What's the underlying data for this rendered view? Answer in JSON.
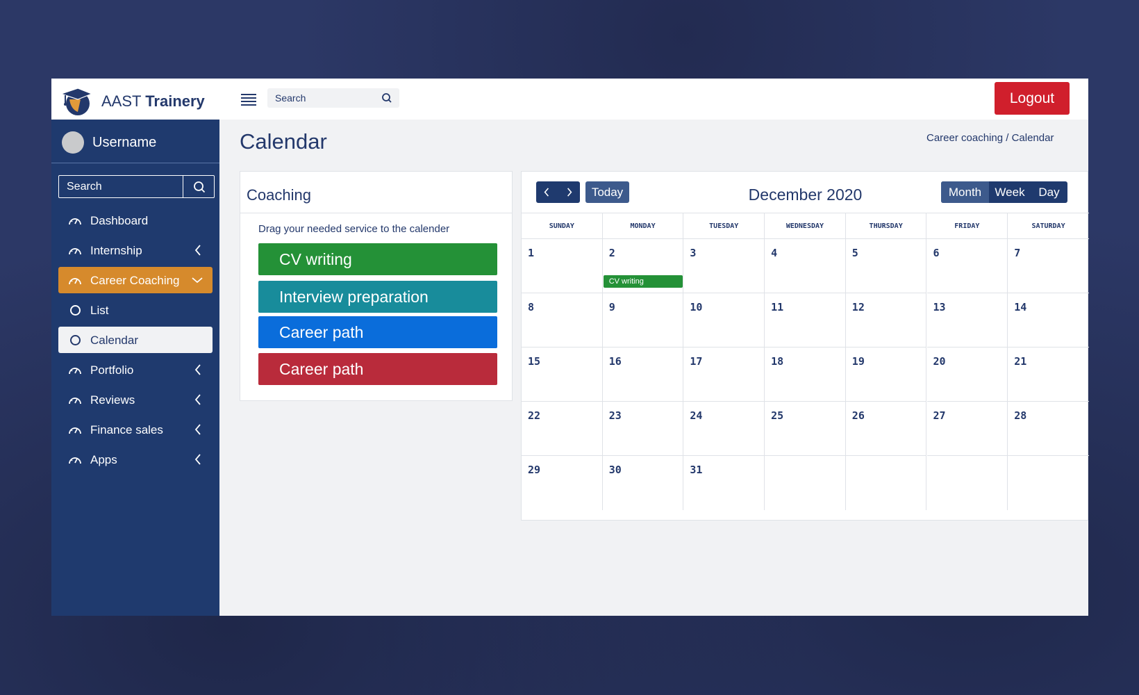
{
  "brand": {
    "prefix": "AAST",
    "name": "Trainery"
  },
  "topbar": {
    "search_placeholder": "Search",
    "logout_label": "Logout"
  },
  "sidebar": {
    "username": "Username",
    "search_placeholder": "Search",
    "items": [
      {
        "label": "Dashboard"
      },
      {
        "label": "Internship"
      },
      {
        "label": "Career Coaching"
      },
      {
        "label": "List"
      },
      {
        "label": "Calendar"
      },
      {
        "label": "Portfolio"
      },
      {
        "label": "Reviews"
      },
      {
        "label": "Finance sales"
      },
      {
        "label": "Apps"
      }
    ]
  },
  "page": {
    "title": "Calendar",
    "breadcrumb": "Career coaching / Calendar"
  },
  "coaching": {
    "title": "Coaching",
    "hint": "Drag your needed service to the calender",
    "services": [
      {
        "label": "CV writing",
        "color": "#249137"
      },
      {
        "label": "Interview preparation",
        "color": "#188c9b"
      },
      {
        "label": "Career path",
        "color": "#0a6ddb"
      },
      {
        "label": "Career path",
        "color": "#b92b3b"
      }
    ]
  },
  "calendar": {
    "month_label": "December 2020",
    "today_label": "Today",
    "views": [
      "Month",
      "Week",
      "Day"
    ],
    "active_view": "Month",
    "weekdays": [
      "SUNDAY",
      "MONDAY",
      "TUESDAY",
      "WEDNESDAY",
      "THURSDAY",
      "FRIDAY",
      "SATURDAY"
    ],
    "days": [
      [
        "1",
        "2",
        "3",
        "4",
        "5",
        "6",
        "7"
      ],
      [
        "8",
        "9",
        "10",
        "11",
        "12",
        "13",
        "14"
      ],
      [
        "15",
        "16",
        "17",
        "18",
        "19",
        "20",
        "21"
      ],
      [
        "22",
        "23",
        "24",
        "25",
        "26",
        "27",
        "28"
      ],
      [
        "29",
        "30",
        "31",
        "",
        "",
        "",
        ""
      ]
    ],
    "events": [
      {
        "day": "2",
        "label": "CV writing",
        "color": "#249137"
      }
    ]
  },
  "colors": {
    "primary": "#1f3a6e",
    "accent": "#d68a2c",
    "danger": "#d01f2c",
    "text": "#23386b"
  }
}
